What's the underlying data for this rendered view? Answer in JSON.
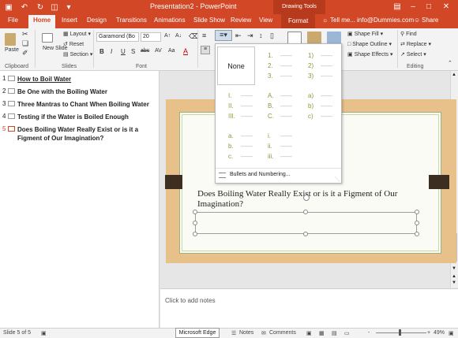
{
  "titlebar": {
    "title": "Presentation2 - PowerPoint",
    "contextual_tab_group": "Drawing Tools",
    "color": "#d24726"
  },
  "tabs": [
    {
      "label": "File"
    },
    {
      "label": "Home"
    },
    {
      "label": "Insert"
    },
    {
      "label": "Design"
    },
    {
      "label": "Transitions"
    },
    {
      "label": "Animations"
    },
    {
      "label": "Slide Show"
    },
    {
      "label": "Review"
    },
    {
      "label": "View"
    },
    {
      "label": "Format"
    },
    {
      "label": "Tell me..."
    },
    {
      "label": "info@Dummies.com"
    },
    {
      "label": "Share"
    }
  ],
  "ribbon": {
    "clipboard": {
      "paste": "Paste",
      "group": "Clipboard"
    },
    "slides": {
      "new_slide": "New Slide",
      "layout": "Layout",
      "reset": "Reset",
      "section": "Section",
      "group": "Slides"
    },
    "font": {
      "name": "Garamond (Bo",
      "size": "20",
      "bold": "B",
      "italic": "I",
      "underline": "U",
      "shadow": "S",
      "strike": "abc",
      "spacing": "AV",
      "case": "Aa",
      "color": "A",
      "group": "Font"
    },
    "drawing": {
      "shape_fill": "Shape Fill",
      "shape_outline": "Shape Outline",
      "shape_effects": "Shape Effects"
    },
    "editing": {
      "find": "Find",
      "replace": "Replace",
      "select": "Select",
      "group": "Editing"
    }
  },
  "outline": [
    {
      "num": "1",
      "text": "How to Boil Water"
    },
    {
      "num": "2",
      "text": "Be One with the Boiling Water"
    },
    {
      "num": "3",
      "text": "Three Mantras to Chant When Boiling Water"
    },
    {
      "num": "4",
      "text": "Testing if the Water is Boiled Enough"
    },
    {
      "num": "5",
      "text": "Does Boiling Water Really Exist or is it a Figment of Our Imagination?"
    }
  ],
  "slide": {
    "title": "Does Boiling Water Really Exist or is it a Figment of Our Imagination?"
  },
  "numbering_menu": {
    "none": "None",
    "styles": [
      [
        "1.",
        "2.",
        "3."
      ],
      [
        "1)",
        "2)",
        "3)"
      ],
      [
        "I.",
        "II.",
        "III."
      ],
      [
        "A.",
        "B.",
        "C."
      ],
      [
        "a)",
        "b)",
        "c)"
      ],
      [
        "a.",
        "b.",
        "c."
      ],
      [
        "i.",
        "ii.",
        "iii."
      ]
    ],
    "footer": "Bullets and Numbering...",
    "accent": "#8a9a3a"
  },
  "notes": {
    "placeholder": "Click to add notes"
  },
  "statusbar": {
    "slide": "Slide 5 of 5",
    "app": "Microsoft Edge",
    "notes": "Notes",
    "comments": "Comments",
    "zoom": "49%",
    "minus": "-",
    "plus": "+"
  }
}
